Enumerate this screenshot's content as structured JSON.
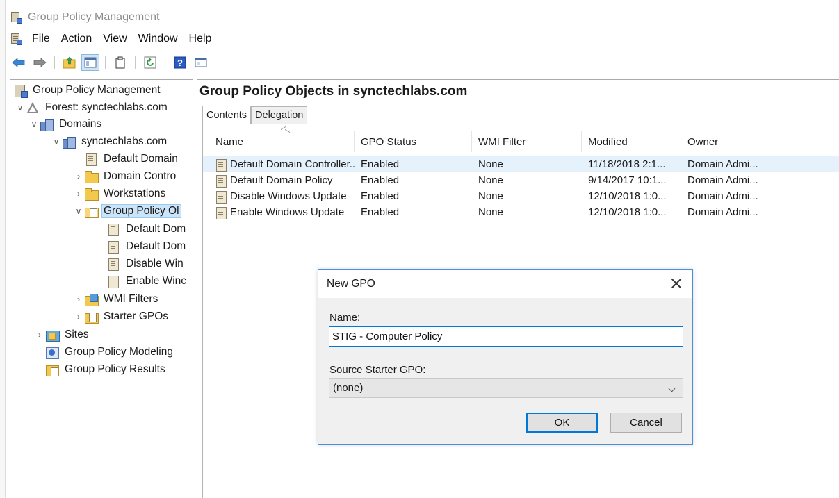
{
  "window": {
    "title": "Group Policy Management"
  },
  "menu": [
    "File",
    "Action",
    "View",
    "Window",
    "Help"
  ],
  "toolbar_icons": [
    "back-arrow-icon",
    "forward-arrow-icon",
    "up-folder-icon",
    "show-hide-tree-icon",
    "clipboard-icon",
    "refresh-icon",
    "help-icon",
    "console-icon"
  ],
  "tree": {
    "root": "Group Policy Management",
    "forest": "Forest: synctechlabs.com",
    "domains": "Domains",
    "domain": "synctechlabs.com",
    "default_domain": "Default Domain",
    "domain_controllers": "Domain Contro",
    "workstations": "Workstations",
    "gpo_folder": "Group Policy Ol",
    "gpo_items": [
      "Default Dom",
      "Default Dom",
      "Disable Win",
      "Enable Winc"
    ],
    "wmi_filters": "WMI Filters",
    "starter_gpos": "Starter GPOs",
    "sites": "Sites",
    "modeling": "Group Policy Modeling",
    "results": "Group Policy Results"
  },
  "right": {
    "title": "Group Policy Objects in synctechlabs.com",
    "tabs": [
      "Contents",
      "Delegation"
    ],
    "columns": [
      "Name",
      "GPO Status",
      "WMI Filter",
      "Modified",
      "Owner"
    ],
    "rows": [
      [
        "Default Domain Controller...",
        "Enabled",
        "None",
        "11/18/2018 2:1...",
        "Domain Admi..."
      ],
      [
        "Default Domain Policy",
        "Enabled",
        "None",
        "9/14/2017 10:1...",
        "Domain Admi..."
      ],
      [
        "Disable Windows Update",
        "Enabled",
        "None",
        "12/10/2018 1:0...",
        "Domain Admi..."
      ],
      [
        "Enable Windows Update",
        "Enabled",
        "None",
        "12/10/2018 1:0...",
        "Domain Admi..."
      ]
    ]
  },
  "dialog": {
    "title": "New GPO",
    "name_label": "Name:",
    "name_value": "STIG - Computer Policy",
    "source_label": "Source Starter GPO:",
    "source_value": "(none)",
    "ok": "OK",
    "cancel": "Cancel"
  },
  "colors": {
    "accent": "#0078d7",
    "selection": "#cce4f7",
    "row_highlight": "#e5f1fb"
  }
}
